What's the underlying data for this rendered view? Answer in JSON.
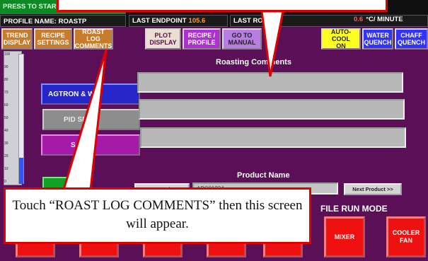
{
  "status": {
    "start_banner": "PRESS TO START PROFILE RUN",
    "profile_name": "PROFILE NAME: ROASTP",
    "last_endpoint_label": "LAST ENDPOINT",
    "last_endpoint_value": "105.6",
    "last_roast_label": "LAST ROAST",
    "rate_value": "0.6",
    "rate_unit": "°C/ MINUTE"
  },
  "tabs": [
    {
      "label": "TREND\nDISPLAY",
      "bg": "#c97b2c",
      "fg": "#ffffff"
    },
    {
      "label": "RECIPE\nSETTINGS",
      "bg": "#c97b2c",
      "fg": "#ffffff"
    },
    {
      "label": "ROAST LOG\nCOMMENTS",
      "bg": "#c97b2c",
      "fg": "#ffffff"
    },
    {
      "label": "PLOT\nDISPLAY",
      "bg": "#eadfd0",
      "fg": "#5a0f56"
    },
    {
      "label": "RECIPE /\nPROFILE",
      "bg": "#b02fd0",
      "fg": "#ffffff"
    },
    {
      "label": "GO TO\nMANUAL",
      "bg": "#b87de0",
      "fg": "#222222"
    },
    {
      "label": "AUTO-COOL\nON",
      "bg": "#ffff22",
      "fg": "#222222"
    },
    {
      "label": "WATER\nQUENCH",
      "bg": "#3333ff",
      "fg": "#ffffff"
    },
    {
      "label": "CHAFF\nQUENCH",
      "bg": "#3333ff",
      "fg": "#ffffff"
    }
  ],
  "scale": {
    "ticks": [
      "100",
      "90",
      "80",
      "70",
      "60",
      "50",
      "40",
      "30",
      "20",
      "10",
      "0"
    ],
    "fill_level": 0.2
  },
  "side_buttons": {
    "agtron": "AGTRON & WE",
    "pid": "PID SE",
    "third": "S"
  },
  "comments": {
    "title": "Roasting Comments"
  },
  "product": {
    "label": "Product Name",
    "value": "ABC01234",
    "prev_button": "Last Product",
    "next_button": "Next Product >>"
  },
  "mode": {
    "title": "FILE RUN MODE"
  },
  "bottom_buttons": {
    "mixer": "MIXER",
    "cooler_fan": "COOLER\nFAN"
  },
  "callout": {
    "text": "Touch “ROAST LOG COMMENTS” then this screen will appear."
  },
  "colors": {
    "background": "#5a0f56",
    "callout_border": "#e00000",
    "button_red": "#ef1010"
  }
}
